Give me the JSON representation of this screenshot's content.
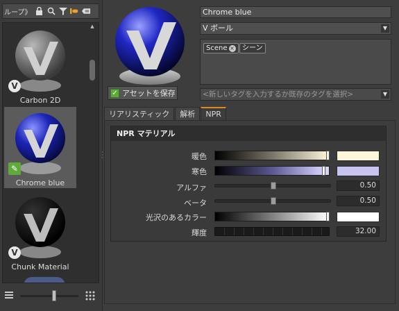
{
  "library": {
    "group_label": "ループ》",
    "items": [
      {
        "label": "Carbon 2D",
        "badge": "V"
      },
      {
        "label": "Chrome blue",
        "badge": "edit"
      },
      {
        "label": "Chunk Material",
        "badge": "V"
      }
    ]
  },
  "asset": {
    "save_label": "アセットを保存",
    "name": "Chrome blue",
    "category": "V ボール",
    "tags": [
      "Scene",
      "シーン"
    ],
    "tag_placeholder": "<新しいタグを入力するか既存のタグを選択>"
  },
  "tabs": [
    {
      "label": "リアリスティック",
      "active": false
    },
    {
      "label": "解析",
      "active": false
    },
    {
      "label": "NPR",
      "active": true
    }
  ],
  "npr": {
    "title": "NPR マテリアル",
    "warm_label": "暖色",
    "cool_label": "寒色",
    "alpha_label": "アルファ",
    "alpha_value": "0.50",
    "alpha_fraction": 0.5,
    "beta_label": "ベータ",
    "beta_value": "0.50",
    "beta_fraction": 0.5,
    "gloss_label": "光沢のあるカラー",
    "brightness_label": "輝度",
    "brightness_value": "32.00",
    "warm_color": "#fdf6dc",
    "cool_color": "#c8c4f0",
    "gloss_color": "#ffffff"
  },
  "colors": {
    "accent": "#e08a1e",
    "badge_edit": "#5faa3a"
  }
}
